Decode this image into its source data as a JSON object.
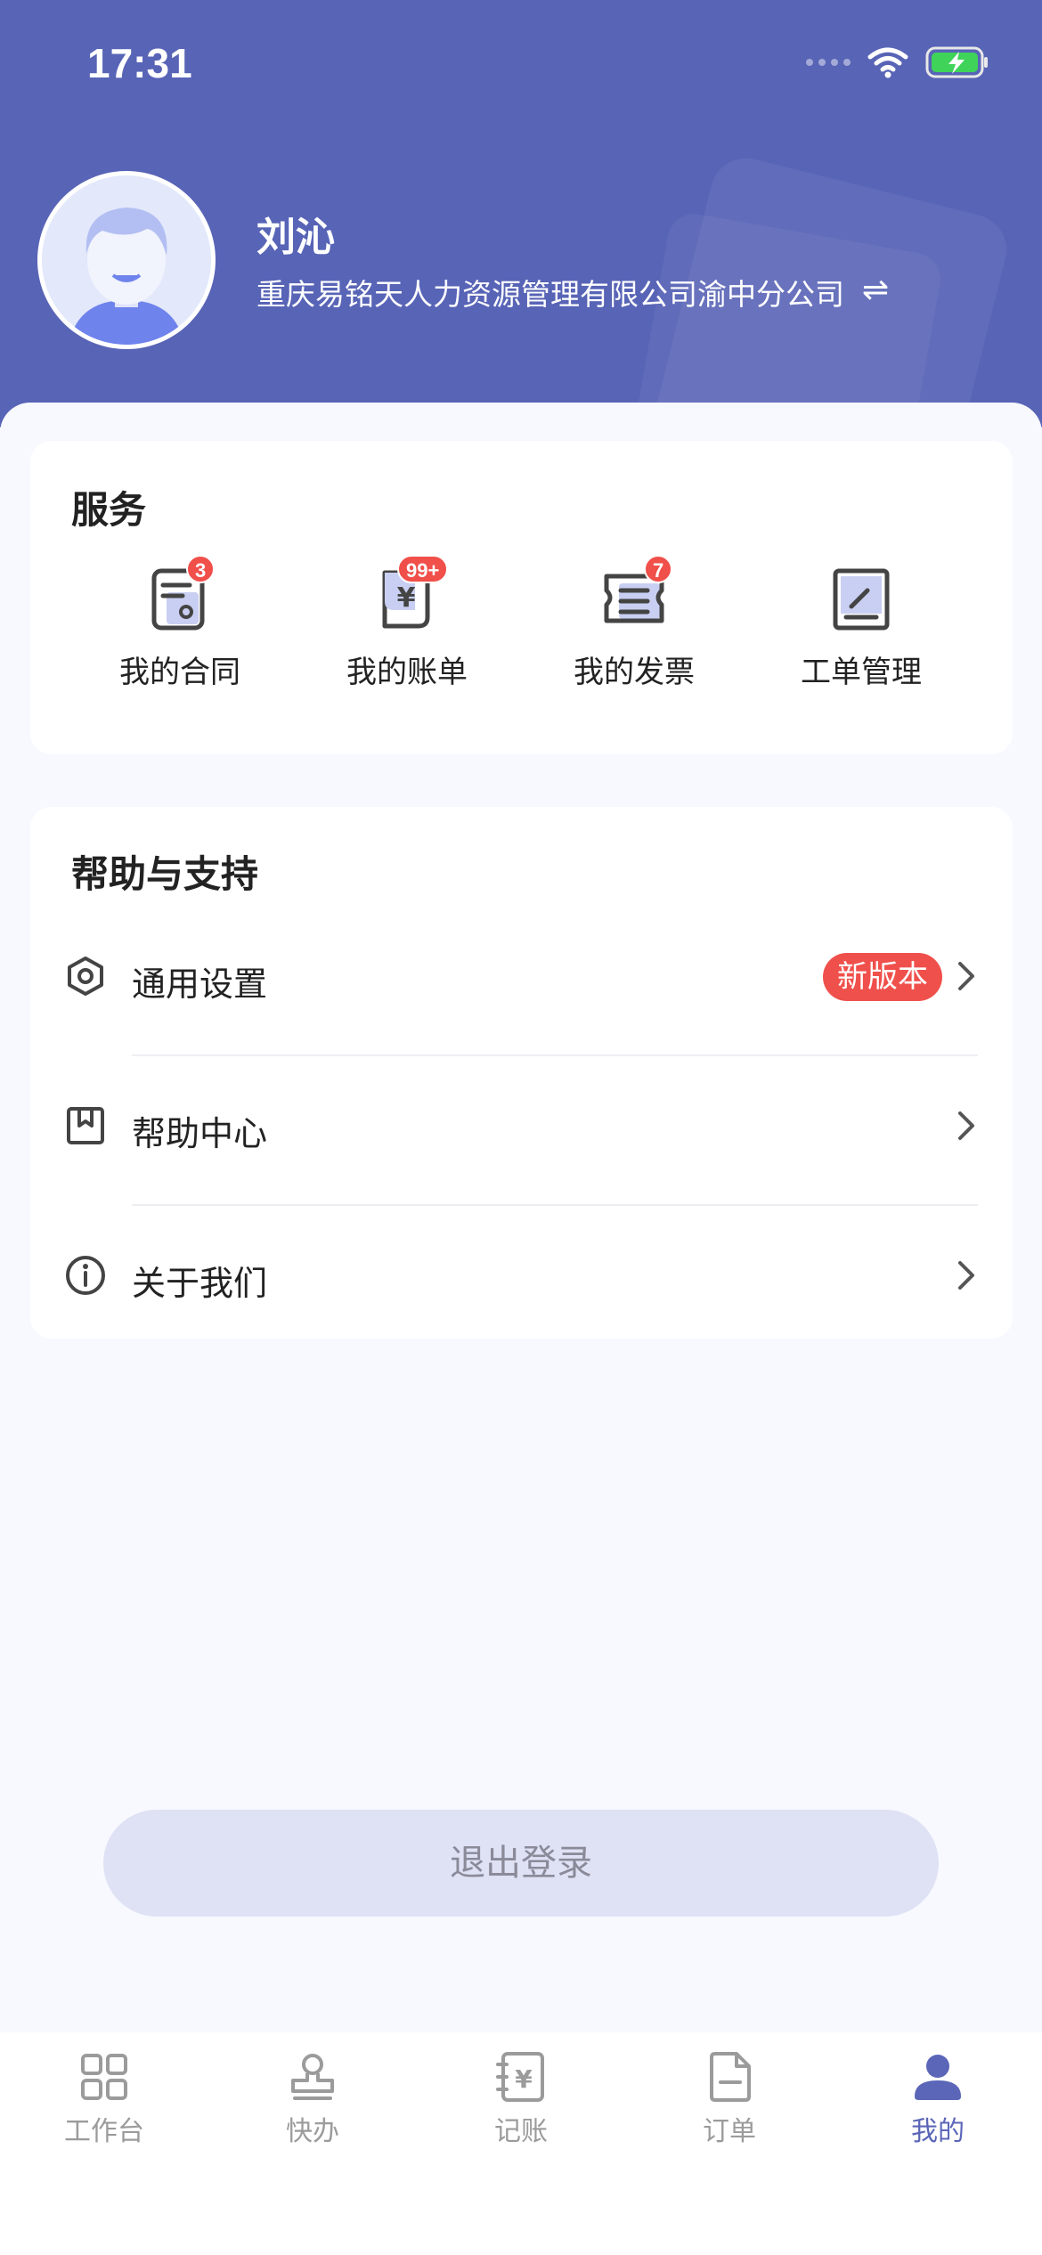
{
  "status_bar": {
    "time": "17:31"
  },
  "profile": {
    "name": "刘沁",
    "company": "重庆易铭天人力资源管理有限公司渝中分公司",
    "switch_icon": "swap-arrows-icon"
  },
  "services": {
    "title": "服务",
    "items": [
      {
        "label": "我的合同",
        "icon": "contract-icon",
        "badge": "3"
      },
      {
        "label": "我的账单",
        "icon": "bill-icon",
        "badge": "99+"
      },
      {
        "label": "我的发票",
        "icon": "invoice-icon",
        "badge": "7"
      },
      {
        "label": "工单管理",
        "icon": "work-order-icon",
        "badge": ""
      }
    ]
  },
  "help": {
    "title": "帮助与支持",
    "items": [
      {
        "label": "通用设置",
        "icon": "settings-icon",
        "badge": "新版本"
      },
      {
        "label": "帮助中心",
        "icon": "bookmark-icon",
        "badge": ""
      },
      {
        "label": "关于我们",
        "icon": "info-icon",
        "badge": ""
      }
    ]
  },
  "logout_label": "退出登录",
  "tabbar": {
    "active": "我的",
    "active_color": "#5b66b8",
    "items": [
      {
        "label": "工作台",
        "icon": "grid-icon"
      },
      {
        "label": "快办",
        "icon": "stamp-icon"
      },
      {
        "label": "记账",
        "icon": "ledger-icon"
      },
      {
        "label": "订单",
        "icon": "order-icon"
      },
      {
        "label": "我的",
        "icon": "person-icon"
      }
    ]
  },
  "colors": {
    "header": "#5864b6",
    "badge": "#f04f4a",
    "accent": "#5b66b8"
  }
}
